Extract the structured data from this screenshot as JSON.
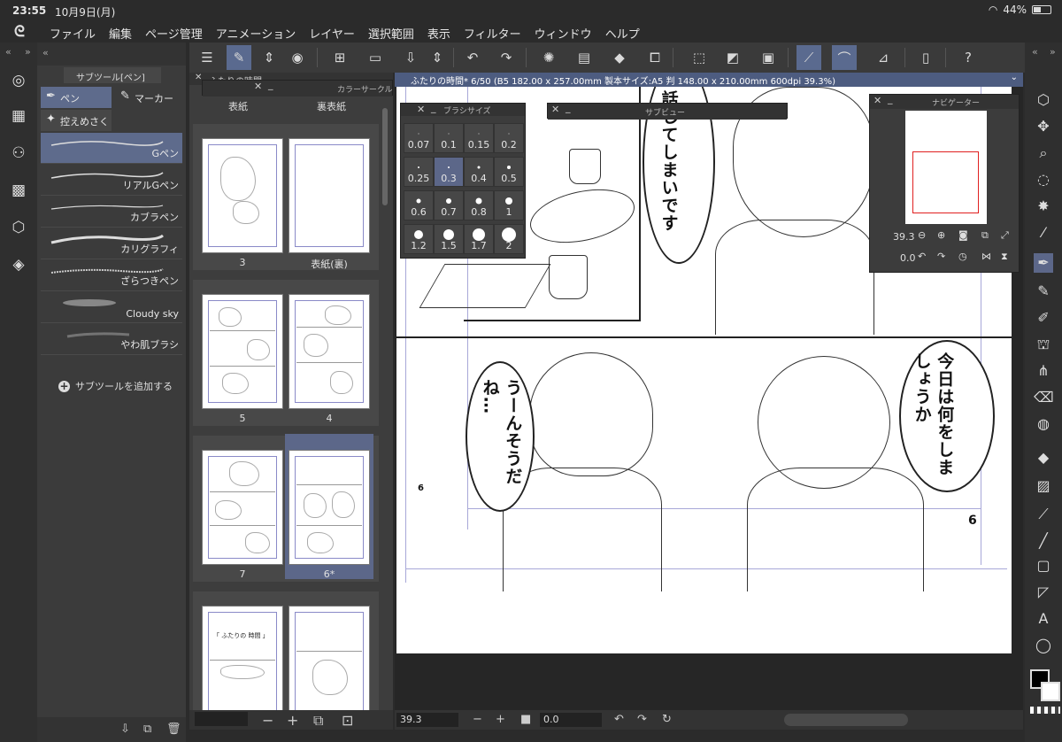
{
  "status": {
    "time": "23:55",
    "date": "10月9日(月)",
    "battery": "44%",
    "icons": [
      "wifi-icon",
      "battery-icon"
    ]
  },
  "menu": {
    "items": [
      "ファイル",
      "編集",
      "ページ管理",
      "アニメーション",
      "レイヤー",
      "選択範囲",
      "表示",
      "フィルター",
      "ウィンドウ",
      "ヘルプ"
    ]
  },
  "subtool": {
    "title": "サブツール[ペン]",
    "groups": [
      "ペン",
      "マーカー",
      "控えめさく"
    ],
    "brushes": [
      "Gペン",
      "リアルGペン",
      "カブラペン",
      "カリグラフィ",
      "ざらつきペン",
      "Cloudy sky",
      "やわ肌ブラシ"
    ],
    "add_label": "サブツールを追加する"
  },
  "pages": {
    "title": "ふたりの時間",
    "cover_labels": [
      "表紙",
      "裏表紙"
    ],
    "thumbs": [
      "3",
      "表紙(裏)",
      "5",
      "4",
      "7",
      "6*"
    ],
    "thumb_text": "「 ふたりの 時間 」"
  },
  "color_circle": {
    "title": "カラーサークル"
  },
  "brush_size": {
    "title": "ブラシサイズ",
    "sizes": [
      "0.07",
      "0.1",
      "0.15",
      "0.2",
      "0.25",
      "0.3",
      "0.4",
      "0.5",
      "0.6",
      "0.7",
      "0.8",
      "1",
      "1.2",
      "1.5",
      "1.7",
      "2"
    ],
    "selected": "0.3"
  },
  "sub_view": {
    "title": "サブビュー"
  },
  "navigator": {
    "title": "ナビゲーター",
    "zoom": "39.3",
    "rotate": "0.0"
  },
  "canvas": {
    "tab": "ふたりの時間* 6/50 (B5 182.00 x 257.00mm 製本サイズ:A5 判 148.00 x 210.00mm 600dpi 39.3%)",
    "bubble_top": "話してしまいです",
    "bubble_right": "今日は何をしましょうか",
    "bubble_left": "うーんそうだね…",
    "page_number": "6",
    "page_number_small": "6"
  },
  "bottom": {
    "zoom": "39.3",
    "rotate": "0.0"
  },
  "colors": {
    "accent": "#5c6789",
    "tab": "#4d5c80",
    "panel": "#3b3b3b",
    "bg": "#2b2b2b"
  }
}
